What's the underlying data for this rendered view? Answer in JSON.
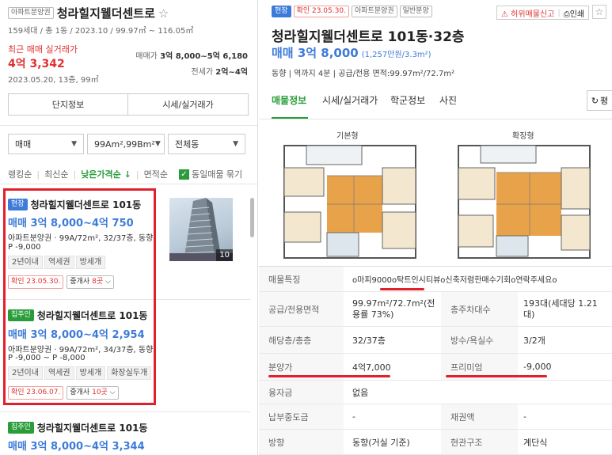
{
  "left": {
    "header": {
      "tag": "아파트분양권",
      "title": "청라힐지웰더센트로",
      "star": "☆",
      "sub": "159세대 / 총 1동 / 2023.10 / 99.97㎡ ~ 116.05㎡",
      "recent_label": "최근 매매 실거래가",
      "recent_price": "4억 3,342",
      "recent_date": "2023.05.20, 13층, 99㎡",
      "sale_label": "매매가",
      "sale_value": "3억 8,000~5억 6,180",
      "rent_label": "전세가",
      "rent_value": "2억~4억"
    },
    "buttons": {
      "complex_info": "단지정보",
      "price_info": "시세/실거래가"
    },
    "filters": {
      "trade": "매매",
      "area": "99Am²,99Bm²",
      "dong": "전체동"
    },
    "sort": {
      "ranking": "랭킹순",
      "latest": "최신순",
      "low_price": "낮은가격순",
      "low_price_arrow": "↓",
      "area": "면적순",
      "group_label": "동일매물 묶기",
      "check": "✓"
    },
    "listings": [
      {
        "tag": "현장",
        "title": "청라힐지웰더센트로 101동",
        "price": "매매 3억 8,000~4억 750",
        "desc1": "아파트분양권 · 99A/72m², 32/37층, 동향",
        "desc2": "P -9,000",
        "features": [
          "2년이내",
          "역세권",
          "방세개"
        ],
        "confirm": "확인 23.05.30.",
        "agent_label": "중개사",
        "agent_count": "8곳",
        "photo_count": "10"
      },
      {
        "tag": "집주인",
        "title": "청라힐지웰더센트로 101동",
        "price": "매매 3억 8,000~4억 2,954",
        "desc1": "아파트분양권 · 99A/72m², 34/37층, 동향",
        "desc2": "P -9,000 ~ P -8,000",
        "features": [
          "2년이내",
          "역세권",
          "방세개",
          "화장실두개"
        ],
        "confirm": "확인 23.06.07.",
        "agent_label": "중개사",
        "agent_count": "10곳"
      },
      {
        "tag": "집주인",
        "title": "청라힐지웰더센트로 101동",
        "price": "매매 3억 8,000~4억 3,344"
      }
    ]
  },
  "right": {
    "tags": [
      "현장",
      "확인 23.05.30.",
      "아파트분양권",
      "일반분양"
    ],
    "report_btn": "허위매물신고",
    "print_btn": "인쇄",
    "star": "☆",
    "title": "청라힐지웰더센트로 101동·32층",
    "price": "매매 3억 8,000",
    "price_unit": "(1,257만원/3.3m²)",
    "summary": "동향 | 역까지 4분 | 공급/전용 면적:99.97m²/72.7m²",
    "tabs": [
      "매물정보",
      "시세/실거래가",
      "학군정보",
      "사진"
    ],
    "refresh_label": "평",
    "floorplans": [
      "기본형",
      "확장형"
    ],
    "table": [
      {
        "label": "매물특징",
        "value": "o마피9000o탁트인시티뷰o신축저렴한매수기회o연락주세요o"
      },
      {
        "label": "공급/전용면적",
        "value": "99.97m²/72.7m²(전용률 73%)",
        "label2": "총주차대수",
        "value2": "193대(세대당 1.21대)"
      },
      {
        "label": "해당층/총층",
        "value": "32/37층",
        "label2": "방수/욕실수",
        "value2": "3/2개"
      },
      {
        "label": "분양가",
        "value": "4억7,000",
        "label2": "프리미엄",
        "value2": "-9,000"
      },
      {
        "label": "융자금",
        "value": "없음"
      },
      {
        "label": "납부중도금",
        "value": "-",
        "label2": "채권액",
        "value2": "-"
      },
      {
        "label": "방향",
        "value": "동향(거실 기준)",
        "label2": "현관구조",
        "value2": "계단식"
      }
    ],
    "colors": {
      "accent": "#3d7bd8",
      "highlight": "#e0202a",
      "tab_active": "#2a9d3a"
    }
  }
}
